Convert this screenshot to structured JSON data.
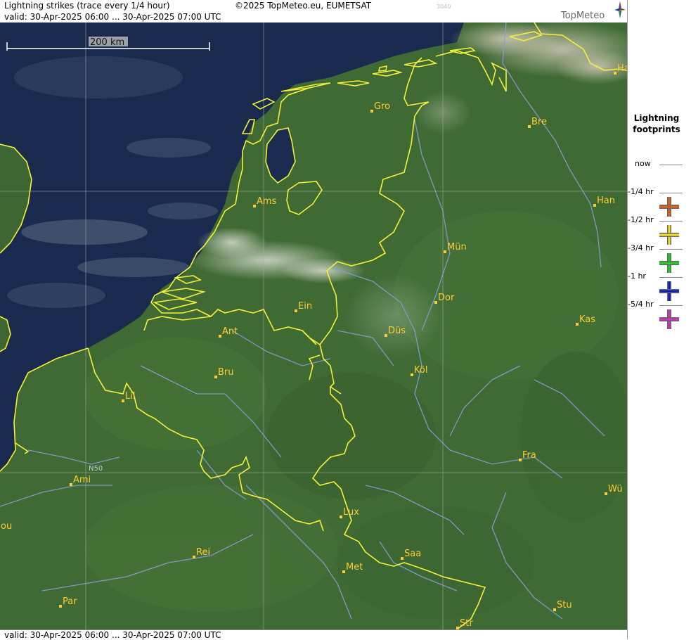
{
  "header": {
    "title": "Lightning strikes (trace every 1/4 hour)",
    "copyright": "©2025 TopMeteo.eu, EUMETSAT",
    "code": "3040",
    "valid": "valid:  30-Apr-2025 06:00 ... 30-Apr-2025 07:00 UTC",
    "logo": "TopMeteo"
  },
  "footer": {
    "valid": "valid:  30-Apr-2025 06:00 ... 30-Apr-2025 07:00 UTC"
  },
  "scale": {
    "label": "200 km"
  },
  "grid": {
    "lat_label": "N50"
  },
  "cities": [
    {
      "name": "Gro"
    },
    {
      "name": "Bre"
    },
    {
      "name": "Ha"
    },
    {
      "name": "Ams"
    },
    {
      "name": "Han"
    },
    {
      "name": "Mün"
    },
    {
      "name": "Dor"
    },
    {
      "name": "Ein"
    },
    {
      "name": "Kas"
    },
    {
      "name": "Ant"
    },
    {
      "name": "Düs"
    },
    {
      "name": "Bru"
    },
    {
      "name": "Köl"
    },
    {
      "name": "Lil"
    },
    {
      "name": "Fra"
    },
    {
      "name": "Ami"
    },
    {
      "name": "Wü"
    },
    {
      "name": "Lux"
    },
    {
      "name": "ou"
    },
    {
      "name": "Rei"
    },
    {
      "name": "Saa"
    },
    {
      "name": "Met"
    },
    {
      "name": "Par"
    },
    {
      "name": "Stu"
    },
    {
      "name": "Str"
    }
  ],
  "legend": {
    "title_line1": "Lightning",
    "title_line2": "footprints",
    "rows": [
      {
        "label": "now",
        "color": ""
      },
      {
        "label": "-1/4 hr",
        "color": "#e0601a"
      },
      {
        "label": "-1/2 hr",
        "color": "#f0e020"
      },
      {
        "label": "-3/4 hr",
        "color": "#20d020"
      },
      {
        "label": "-1 hr",
        "color": "#1020c0"
      },
      {
        "label": "-5/4 hr",
        "color": "#d030c0"
      }
    ]
  },
  "colors": {
    "sea": "#1a2a4e",
    "land": "#3f6a34",
    "border": "#f5ef3a",
    "river": "#8a9ad8",
    "city_label": "#ffcc33"
  }
}
